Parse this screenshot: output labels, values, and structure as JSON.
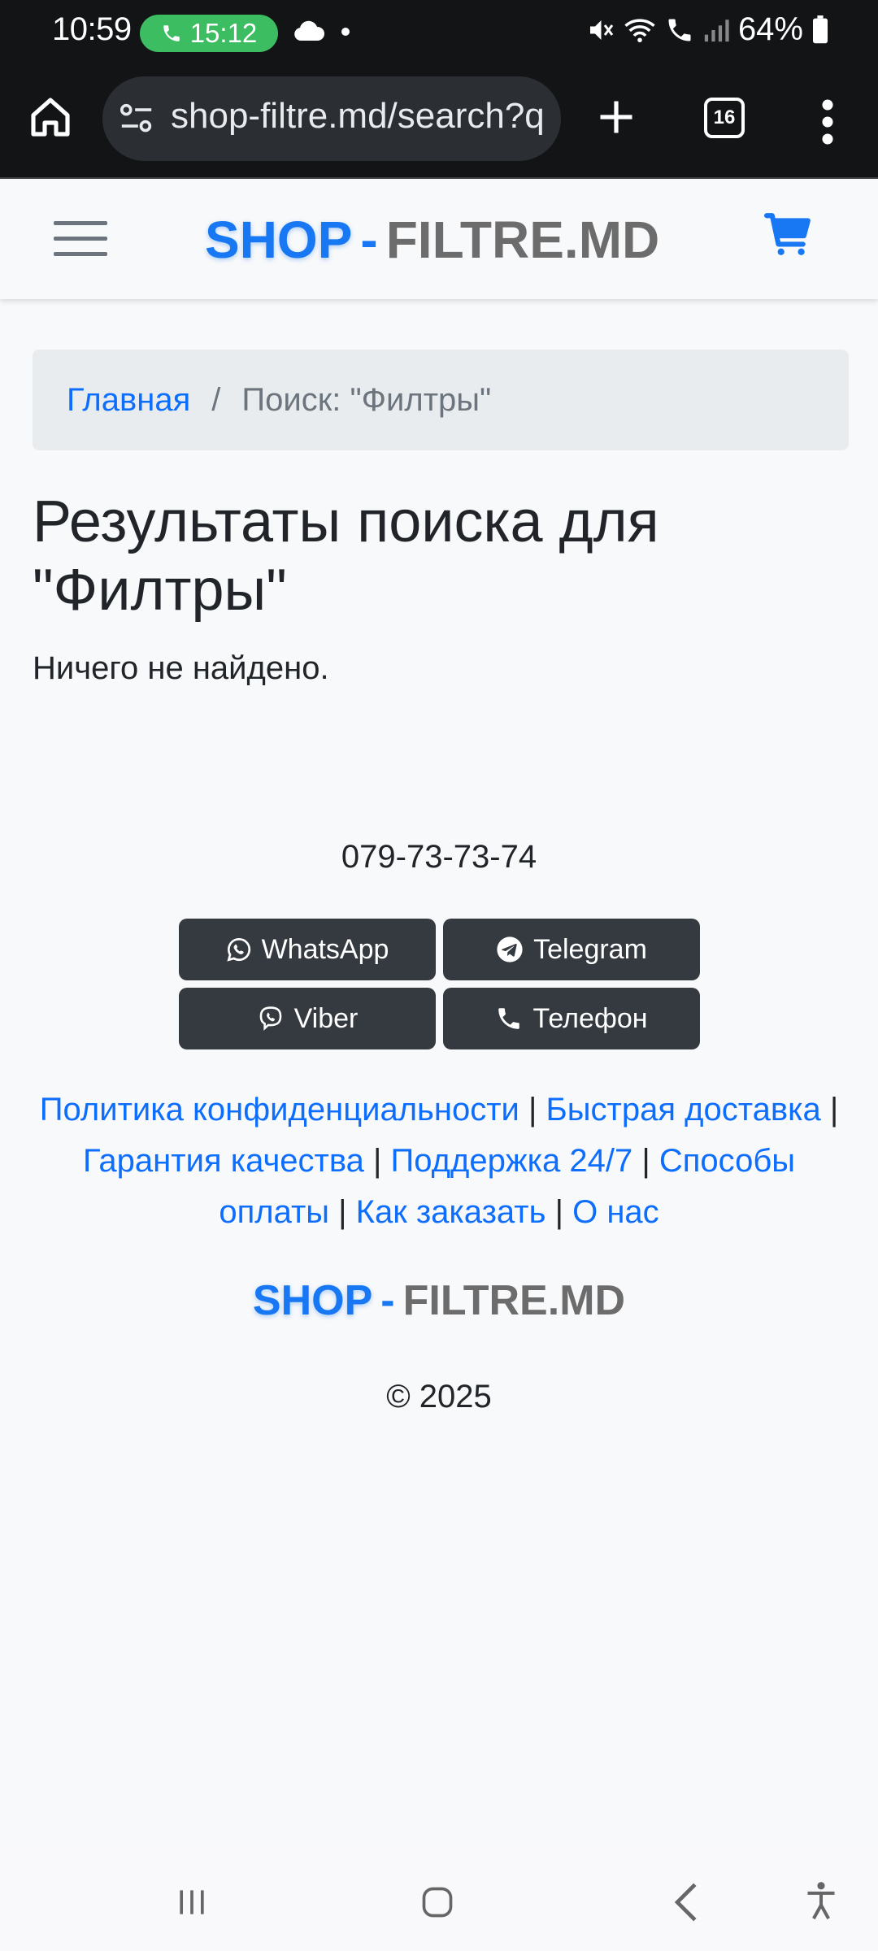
{
  "status_bar": {
    "time": "10:59",
    "call_timer": "15:12",
    "battery": "64%"
  },
  "browser": {
    "url": "shop-filtre.md/search?q",
    "tab_count": "16"
  },
  "site": {
    "brand_part1": "SHOP",
    "brand_dash": "-",
    "brand_part2": "FILTRE.MD"
  },
  "breadcrumb": {
    "home": "Главная",
    "separator": "/",
    "current": "Поиск: \"Филтры\""
  },
  "main": {
    "title": "Результаты поиска для \"Филтры\"",
    "empty_message": "Ничего не найдено."
  },
  "footer": {
    "phone": "079-73-73-74",
    "buttons": {
      "whatsapp": "WhatsApp",
      "telegram": "Telegram",
      "viber": "Viber",
      "phone": "Телефон"
    },
    "links": {
      "privacy": "Политика конфиденциальности",
      "delivery": "Быстрая доставка",
      "quality": "Гарантия качества",
      "support": "Поддержка 24/7",
      "payment": "Способы оплаты",
      "how_to_order": "Как заказать",
      "about": "О нас"
    },
    "separator": "|",
    "copyright": "© 2025"
  },
  "colors": {
    "brand_blue": "#1877f2",
    "brand_gray": "#6c6c6c",
    "link_blue": "#0d6efd",
    "button_dark": "#343a40",
    "call_green": "#3dbd62"
  }
}
